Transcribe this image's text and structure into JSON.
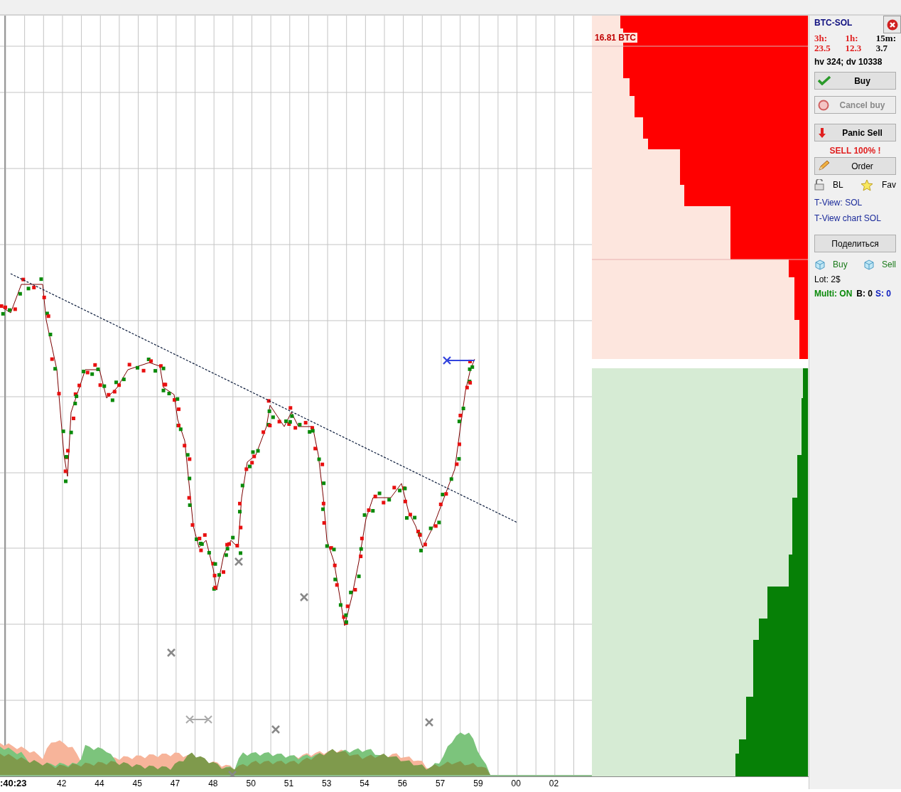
{
  "order_book": {
    "label": "16.81 BTC"
  },
  "x_axis": {
    "labels": [
      ":40:23",
      "42",
      "44",
      "45",
      "47",
      "48",
      "50",
      "51",
      "53",
      "54",
      "56",
      "57",
      "59",
      "00",
      "02"
    ]
  },
  "panel": {
    "pair": "BTC-SOL",
    "stats": [
      {
        "label": "3h:",
        "value": "23.5",
        "color": "#e02020"
      },
      {
        "label": "1h:",
        "value": "12.3",
        "color": "#e02020"
      },
      {
        "label": "15m:",
        "value": "3.7",
        "color": "#000000"
      }
    ],
    "volume_line": "hv 324; dv 10338",
    "buttons": [
      {
        "kind": "buy",
        "label": "Buy",
        "disabled": false
      },
      {
        "kind": "cancel",
        "label": "Cancel buy",
        "disabled": true
      },
      {
        "kind": "panic",
        "label": "Panic Sell",
        "disabled": false
      }
    ],
    "sell_warning": "SELL 100% !",
    "order_button": "Order",
    "toggles": [
      {
        "kind": "lock",
        "label": "BL"
      },
      {
        "kind": "star",
        "label": "Fav"
      }
    ],
    "links": [
      "T-View: SOL",
      "T-View chart SOL"
    ],
    "share_button": "Поделиться",
    "quick": [
      {
        "label": "Buy"
      },
      {
        "label": "Sell"
      }
    ],
    "lot": "Lot: 2$",
    "multi": "Multi: ON",
    "b_count": "B: 0",
    "s_count": "S: 0"
  }
}
